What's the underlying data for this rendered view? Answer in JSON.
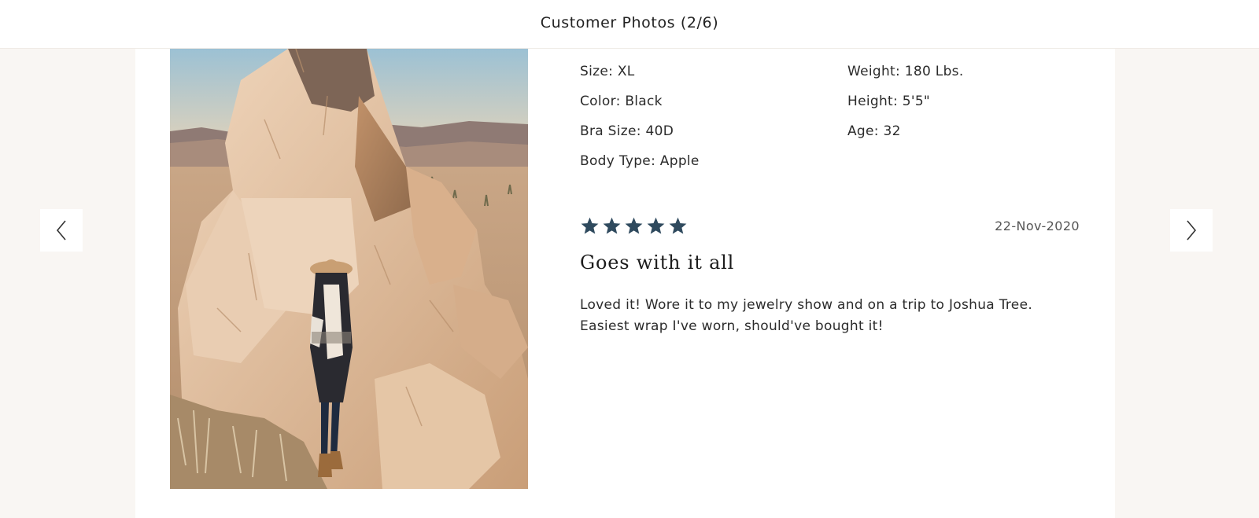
{
  "header": {
    "title": "Customer Photos (2/6)"
  },
  "review": {
    "attributes_left": [
      "Size: XL",
      "Color: Black",
      "Bra Size: 40D",
      "Body Type: Apple"
    ],
    "attributes_right": [
      "Weight: 180 Lbs.",
      "Height: 5'5\"",
      "Age: 32"
    ],
    "rating": 5,
    "rating_max": 5,
    "date": "22-Nov-2020",
    "title": "Goes with it all",
    "body": "Loved it! Wore it to my jewelry show and on a trip to Joshua Tree. Easiest wrap I've worn, should've bought it!"
  },
  "navigation": {
    "prev_icon": "chevron-left-icon",
    "next_icon": "chevron-right-icon"
  },
  "colors": {
    "star": "#2f4a5e",
    "page_background": "#f9f6f3",
    "card_background": "#ffffff"
  }
}
